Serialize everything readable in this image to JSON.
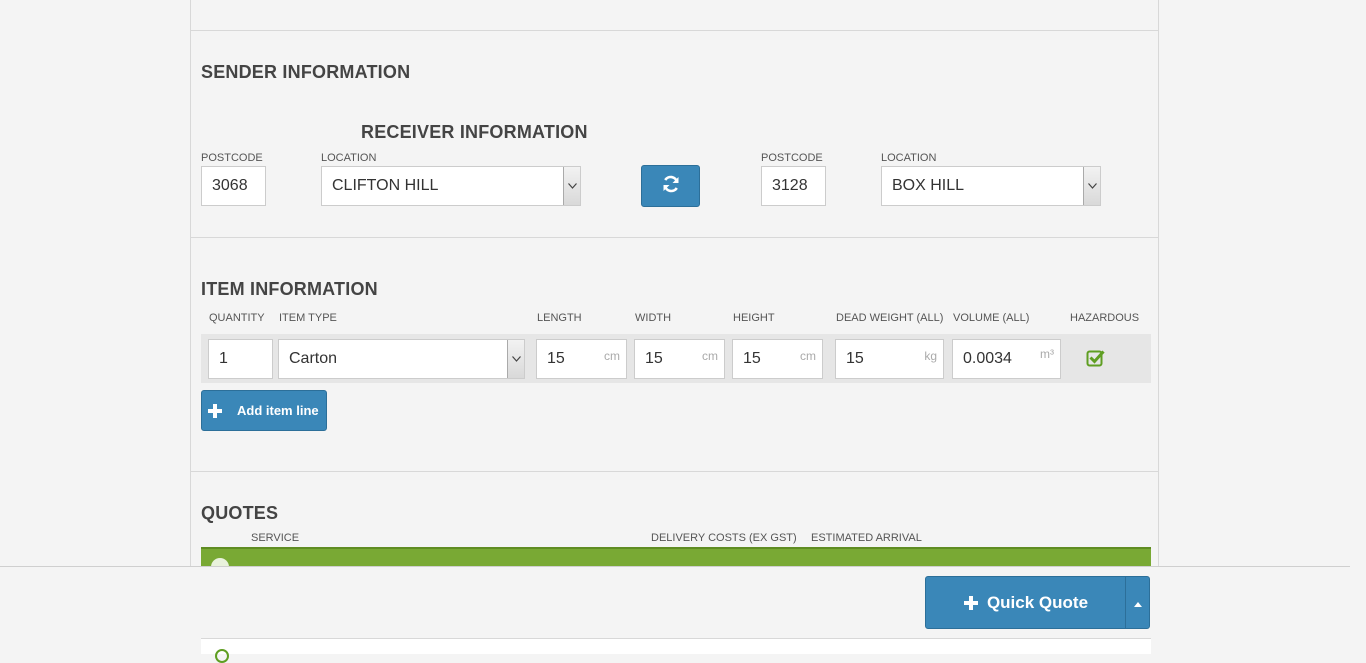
{
  "sender": {
    "title": "SENDER INFORMATION",
    "postcode_label": "POSTCODE",
    "postcode_value": "3068",
    "location_label": "LOCATION",
    "location_value": "CLIFTON HILL"
  },
  "receiver": {
    "title": "RECEIVER INFORMATION",
    "postcode_label": "POSTCODE",
    "postcode_value": "3128",
    "location_label": "LOCATION",
    "location_value": "BOX HILL"
  },
  "swap_button": {
    "icon": "refresh-icon"
  },
  "items": {
    "title": "ITEM INFORMATION",
    "headers": {
      "quantity": "QUANTITY",
      "item_type": "ITEM TYPE",
      "length": "LENGTH",
      "width": "WIDTH",
      "height": "HEIGHT",
      "dead_weight": "DEAD WEIGHT (ALL)",
      "volume": "VOLUME (ALL)",
      "hazardous": "HAZARDOUS"
    },
    "row": {
      "quantity": "1",
      "item_type": "Carton",
      "length": "15",
      "length_unit": "cm",
      "width": "15",
      "width_unit": "cm",
      "height": "15",
      "height_unit": "cm",
      "dead_weight": "15",
      "dead_weight_unit": "kg",
      "volume": "0.0034",
      "volume_unit": "m³",
      "hazardous_checked": true
    },
    "add_button_label": "Add item line"
  },
  "quotes": {
    "title": "QUOTES",
    "headers": {
      "service": "SERVICE",
      "delivery_costs": "DELIVERY COSTS (EX GST)",
      "estimated_arrival": "ESTIMATED ARRIVAL"
    }
  },
  "footer": {
    "quick_quote_label": "Quick Quote"
  },
  "colors": {
    "accent_blue": "#3a87b8",
    "selected_green": "#79a934",
    "checkbox_green": "#5f9e22"
  }
}
